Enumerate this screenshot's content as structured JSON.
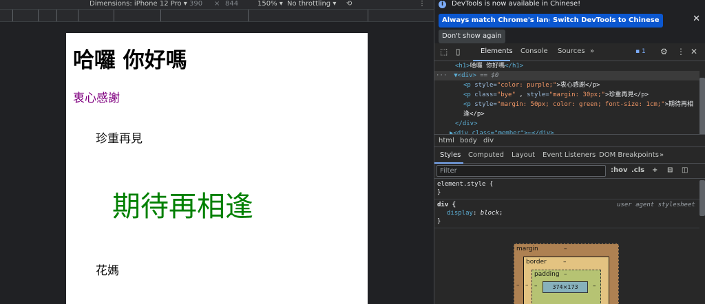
{
  "device_toolbar": {
    "dimensions_label": "Dimensions: iPhone 12 Pro",
    "width": "390",
    "times": "×",
    "height": "844",
    "zoom": "150%",
    "throttling": "No throttling"
  },
  "page": {
    "h1": "哈囉 你好嗎",
    "p_purple": "衷心感謝",
    "p_bye": "珍重再見",
    "p_green": "期待再相逢",
    "p_flower": "花媽"
  },
  "infobar": {
    "message": "DevTools is now available in Chinese!",
    "btn_match": "Always match Chrome's language",
    "btn_switch": "Switch DevTools to Chinese",
    "btn_dont_show": "Don't show again"
  },
  "main_tabs": {
    "elements": "Elements",
    "console": "Console",
    "sources": "Sources",
    "more": "»",
    "issues_count": "1"
  },
  "dom_tree": {
    "line1_open": "<h1>",
    "line1_text": "哈囉  你好嗎",
    "line1_close": "</h1>",
    "line2_dots": "···",
    "line2_tag": "▼<div>",
    "line2_eq": " == $0",
    "line3_a": "<p ",
    "line3_attr": "style=",
    "line3_val": "\"color: purple;\"",
    "line3_text": ">衷心感謝</p>",
    "line4_a": "<p ",
    "line4_attr1": "class=",
    "line4_val1": "\"bye\"",
    "line4_sep": " , ",
    "line4_attr2": "style=",
    "line4_val2": "\"margin: 30px;\"",
    "line4_text": ">珍重再見</p>",
    "line5_a": "<p ",
    "line5_attr": "style=",
    "line5_val": "\"margin: 50px; color: green; font-size: 1cm;\"",
    "line5_text": ">期待再相",
    "line6_text": "逢</p>",
    "line7": "</div>",
    "line8": "▶<div class=\"member\">⋯</div>"
  },
  "breadcrumbs": [
    "html",
    "body",
    "div"
  ],
  "sub_tabs": {
    "styles": "Styles",
    "computed": "Computed",
    "layout": "Layout",
    "event_listeners": "Event Listeners",
    "dom_breakpoints": "DOM Breakpoints",
    "more": "»"
  },
  "filter": {
    "placeholder": "Filter",
    "hov": ":hov",
    "cls": ".cls"
  },
  "styles_pane": {
    "element_style_selector": "element.style {",
    "element_style_close": "}",
    "div_selector": "div {",
    "ua_label": "user agent stylesheet",
    "div_prop": "display",
    "div_colon": ": ",
    "div_val": "block",
    "div_semi": ";",
    "div_close": "}"
  },
  "box_model": {
    "margin_label": "margin",
    "margin_value": "–",
    "border_label": "border",
    "border_value": "–",
    "padding_label": "padding",
    "padding_value": "–",
    "content_size": "374×173",
    "side_dash": "–"
  },
  "colors": {
    "accent": "#7cacf8",
    "primary_button": "#0b57d0",
    "purple_text": "#800080",
    "green_text": "#008000"
  }
}
